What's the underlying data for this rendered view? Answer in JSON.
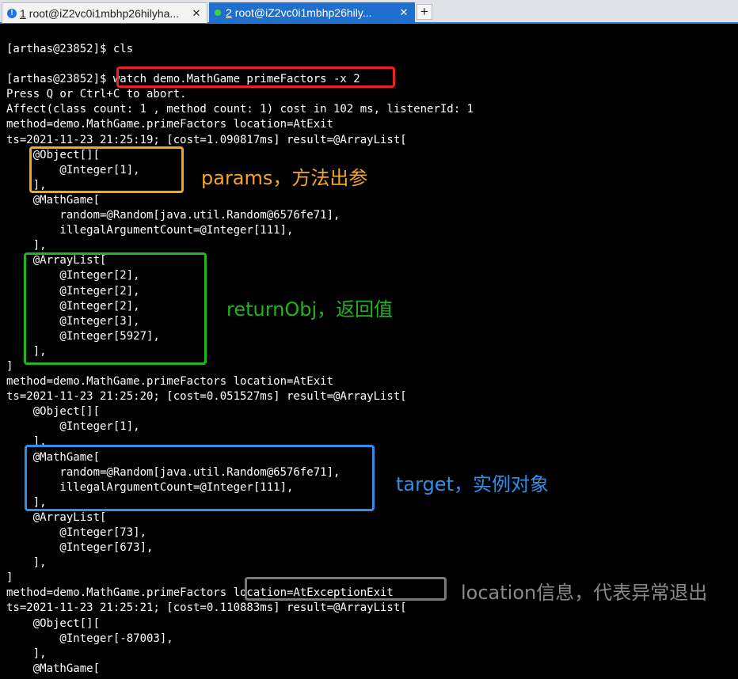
{
  "tabs": [
    {
      "num": "1",
      "title": "root@iZ2vc0i1mbhp26hilyha...",
      "active": false
    },
    {
      "num": "2",
      "title": "root@iZ2vc0i1mbhp26hily...",
      "active": true
    }
  ],
  "new_tab": "+",
  "close_glyph": "✕",
  "terminal_lines": [
    "[arthas@23852]$ cls",
    "",
    "[arthas@23852]$ watch demo.MathGame primeFactors -x 2",
    "Press Q or Ctrl+C to abort.",
    "Affect(class count: 1 , method count: 1) cost in 102 ms, listenerId: 1",
    "method=demo.MathGame.primeFactors location=AtExit",
    "ts=2021-11-23 21:25:19; [cost=1.090817ms] result=@ArrayList[",
    "    @Object[][",
    "        @Integer[1],",
    "    ],",
    "    @MathGame[",
    "        random=@Random[java.util.Random@6576fe71],",
    "        illegalArgumentCount=@Integer[111],",
    "    ],",
    "    @ArrayList[",
    "        @Integer[2],",
    "        @Integer[2],",
    "        @Integer[2],",
    "        @Integer[3],",
    "        @Integer[5927],",
    "    ],",
    "]",
    "method=demo.MathGame.primeFactors location=AtExit",
    "ts=2021-11-23 21:25:20; [cost=0.051527ms] result=@ArrayList[",
    "    @Object[][",
    "        @Integer[1],",
    "    ],",
    "    @MathGame[",
    "        random=@Random[java.util.Random@6576fe71],",
    "        illegalArgumentCount=@Integer[111],",
    "    ],",
    "    @ArrayList[",
    "        @Integer[73],",
    "        @Integer[673],",
    "    ],",
    "]",
    "method=demo.MathGame.primeFactors location=AtExceptionExit",
    "ts=2021-11-23 21:25:21; [cost=0.110883ms] result=@ArrayList[",
    "    @Object[][",
    "        @Integer[-87003],",
    "    ],",
    "    @MathGame["
  ],
  "annotations": {
    "params": "params，方法出参",
    "returnObj": "returnObj，返回值",
    "target": "target，实例对象",
    "location": "location信息，代表异常退出"
  },
  "colors": {
    "command_box": "#e8231f",
    "params": "#f5a623",
    "returnObj": "#21b41e",
    "target": "#2f8fe8",
    "location": "#8a8a8a"
  }
}
